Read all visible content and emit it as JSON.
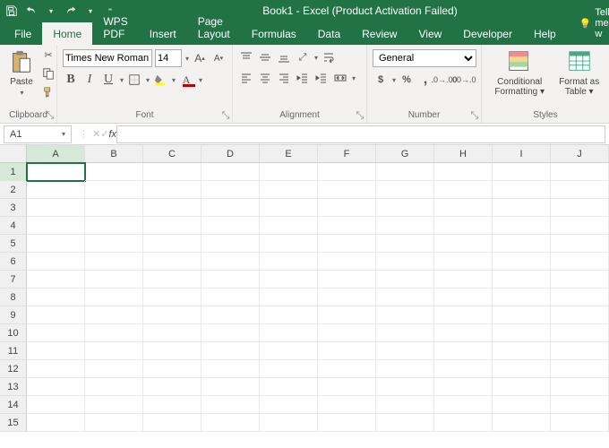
{
  "title": "Book1 - Excel (Product Activation Failed)",
  "qat": {
    "save": "save",
    "undo": "undo",
    "redo": "redo"
  },
  "tabs": {
    "file": "File",
    "home": "Home",
    "wps": "WPS PDF",
    "insert": "Insert",
    "pagelayout": "Page Layout",
    "formulas": "Formulas",
    "data": "Data",
    "review": "Review",
    "view": "View",
    "developer": "Developer",
    "help": "Help"
  },
  "tellme": "Tell me w",
  "groups": {
    "clipboard": {
      "label": "Clipboard",
      "paste": "Paste"
    },
    "font": {
      "label": "Font",
      "name": "Times New Roman",
      "size": "14"
    },
    "alignment": {
      "label": "Alignment"
    },
    "number": {
      "label": "Number",
      "format": "General"
    },
    "styles": {
      "label": "Styles",
      "cond": "Conditional Formatting ▾",
      "table": "Format as Table ▾"
    }
  },
  "namebox": "A1",
  "fx": "fx",
  "columns": [
    "A",
    "B",
    "C",
    "D",
    "E",
    "F",
    "G",
    "H",
    "I",
    "J"
  ],
  "rows": [
    "1",
    "2",
    "3",
    "4",
    "5",
    "6",
    "7",
    "8",
    "9",
    "10",
    "11",
    "12",
    "13",
    "14",
    "15"
  ],
  "selected": {
    "col": 0,
    "row": 0
  },
  "colors": {
    "accent": "#217346",
    "fill": "#ffff00",
    "font": "#c00000"
  }
}
